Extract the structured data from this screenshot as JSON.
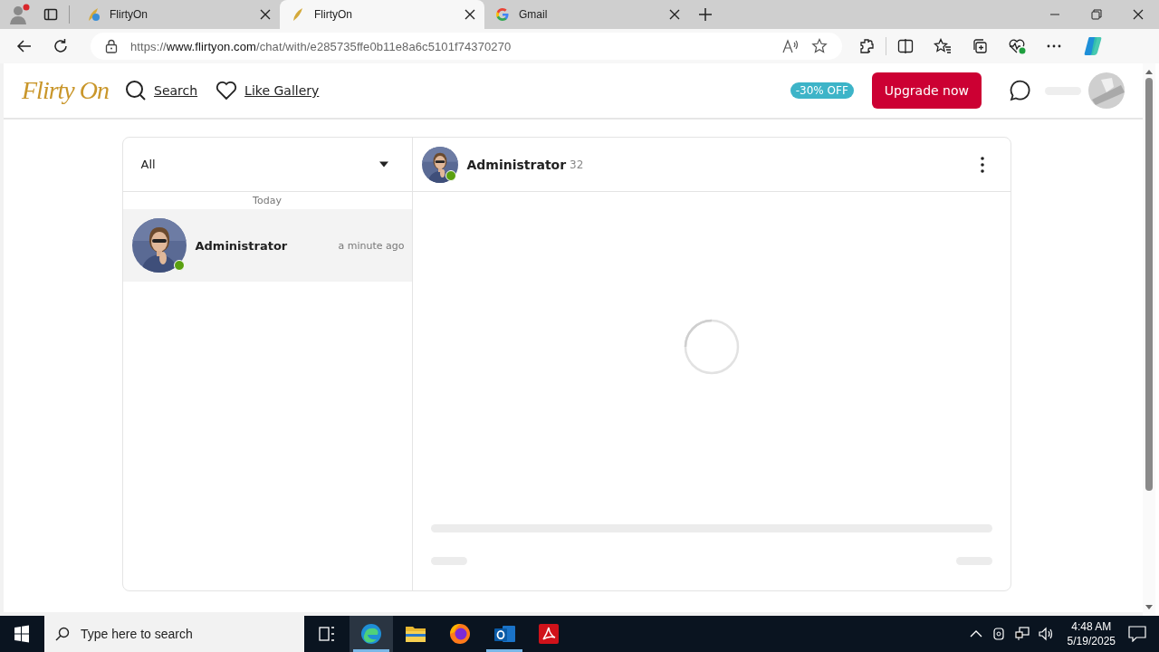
{
  "browser": {
    "tabs": [
      {
        "title": "FlirtyOn",
        "selected": false,
        "kind": "site-alt"
      },
      {
        "title": "FlirtyOn",
        "selected": true,
        "kind": "site"
      },
      {
        "title": "Gmail",
        "selected": false,
        "kind": "mail"
      }
    ],
    "url": {
      "scheme": "https://",
      "host": "www.flirtyon.com",
      "path": "/chat/with/e285735ffe0b11e8a6c5101f74370270"
    }
  },
  "header": {
    "logo": "Flirty On",
    "nav": [
      {
        "label": "Search",
        "kind": "search"
      },
      {
        "label": "Like Gallery",
        "kind": "heart"
      }
    ],
    "discount": "-30% OFF",
    "upgrade": "Upgrade now"
  },
  "chat": {
    "filter": "All",
    "date_label": "Today",
    "conversations": [
      {
        "name": "Administrator",
        "time": "a minute ago",
        "online": true,
        "selected": true
      }
    ],
    "partner": {
      "name": "Administrator",
      "age": "32",
      "online": true
    }
  },
  "taskbar": {
    "search_placeholder": "Type here to search",
    "time": "4:48 AM",
    "date": "5/19/2025"
  }
}
